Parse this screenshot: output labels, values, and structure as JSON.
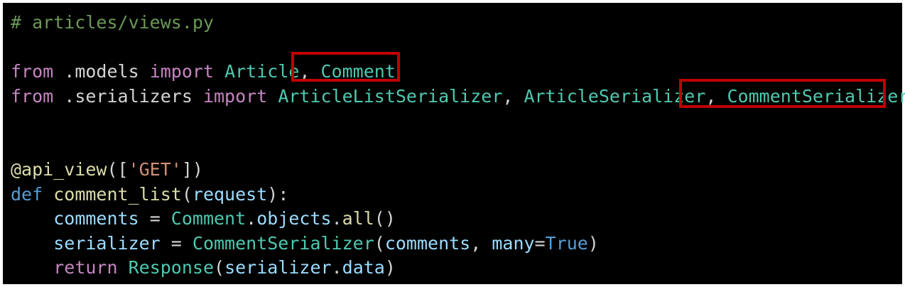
{
  "colors": {
    "background": "#000000",
    "comment": "#6a9955",
    "keyword": "#c586c0",
    "def_keyword": "#569cd6",
    "class_name": "#4ec9b0",
    "function_name": "#dcdcaa",
    "variable": "#9cdcfe",
    "string": "#ce9178",
    "constant": "#569cd6",
    "plain": "#d4d4d4",
    "highlight_box": "#c00000"
  },
  "code": {
    "lines": [
      [
        {
          "t": "# articles/views.py",
          "c": "comment"
        }
      ],
      [],
      [
        {
          "t": "from",
          "c": "keyword"
        },
        {
          "t": " .models ",
          "c": "plain"
        },
        {
          "t": "import",
          "c": "keyword"
        },
        {
          "t": " ",
          "c": "plain"
        },
        {
          "t": "Article",
          "c": "class"
        },
        {
          "t": ", ",
          "c": "plain"
        },
        {
          "t": "Comment",
          "c": "class"
        }
      ],
      [
        {
          "t": "from",
          "c": "keyword"
        },
        {
          "t": " .serializers ",
          "c": "plain"
        },
        {
          "t": "import",
          "c": "keyword"
        },
        {
          "t": " ",
          "c": "plain"
        },
        {
          "t": "ArticleListSerializer",
          "c": "class"
        },
        {
          "t": ", ",
          "c": "plain"
        },
        {
          "t": "ArticleSerializer",
          "c": "class"
        },
        {
          "t": ", ",
          "c": "plain"
        },
        {
          "t": "CommentSerializer",
          "c": "class"
        }
      ],
      [],
      [],
      [
        {
          "t": "@api_view",
          "c": "func"
        },
        {
          "t": "([",
          "c": "plain"
        },
        {
          "t": "'GET'",
          "c": "string"
        },
        {
          "t": "])",
          "c": "plain"
        }
      ],
      [
        {
          "t": "def",
          "c": "def"
        },
        {
          "t": " ",
          "c": "plain"
        },
        {
          "t": "comment_list",
          "c": "func"
        },
        {
          "t": "(",
          "c": "plain"
        },
        {
          "t": "request",
          "c": "var"
        },
        {
          "t": "):",
          "c": "plain"
        }
      ],
      [
        {
          "t": "    ",
          "c": "plain"
        },
        {
          "t": "comments",
          "c": "var"
        },
        {
          "t": " = ",
          "c": "plain"
        },
        {
          "t": "Comment",
          "c": "class"
        },
        {
          "t": ".",
          "c": "plain"
        },
        {
          "t": "objects",
          "c": "var"
        },
        {
          "t": ".",
          "c": "plain"
        },
        {
          "t": "all",
          "c": "func"
        },
        {
          "t": "()",
          "c": "plain"
        }
      ],
      [
        {
          "t": "    ",
          "c": "plain"
        },
        {
          "t": "serializer",
          "c": "var"
        },
        {
          "t": " = ",
          "c": "plain"
        },
        {
          "t": "CommentSerializer",
          "c": "class"
        },
        {
          "t": "(",
          "c": "plain"
        },
        {
          "t": "comments",
          "c": "var"
        },
        {
          "t": ", ",
          "c": "plain"
        },
        {
          "t": "many",
          "c": "var"
        },
        {
          "t": "=",
          "c": "plain"
        },
        {
          "t": "True",
          "c": "const"
        },
        {
          "t": ")",
          "c": "plain"
        }
      ],
      [
        {
          "t": "    ",
          "c": "plain"
        },
        {
          "t": "return",
          "c": "keyword"
        },
        {
          "t": " ",
          "c": "plain"
        },
        {
          "t": "Response",
          "c": "class"
        },
        {
          "t": "(",
          "c": "plain"
        },
        {
          "t": "serializer",
          "c": "var"
        },
        {
          "t": ".",
          "c": "plain"
        },
        {
          "t": "data",
          "c": "var"
        },
        {
          "t": ")",
          "c": "plain"
        }
      ]
    ]
  }
}
